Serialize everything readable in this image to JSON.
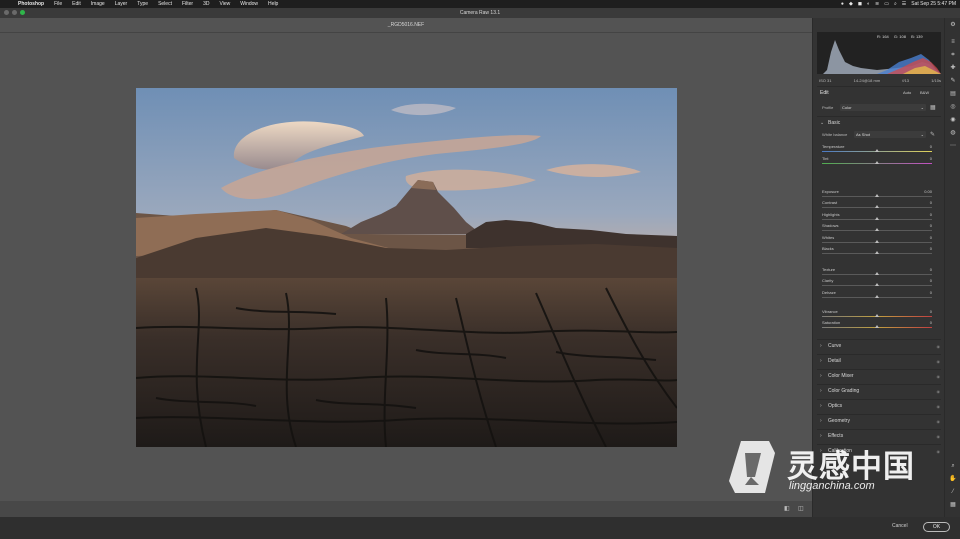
{
  "menubar": {
    "apple": "",
    "items": [
      "Photoshop",
      "File",
      "Edit",
      "Image",
      "Layer",
      "Type",
      "Select",
      "Filter",
      "3D",
      "View",
      "Window",
      "Help"
    ],
    "clock": "Sat Sep 25  5:47 PM"
  },
  "window": {
    "title": "Camera Raw 13.1"
  },
  "file": {
    "name": "_RGD5016.NEF"
  },
  "histogram": {
    "r": "R: 164",
    "g": "G: 108",
    "b": "B: 139"
  },
  "exif": {
    "iso": "ISO 31",
    "lens": "14-24@18 mm",
    "aperture": "f/13",
    "shutter": "1/10s"
  },
  "edit": {
    "title": "Edit",
    "auto": "Auto",
    "bw": "B&W"
  },
  "profile": {
    "label": "Profile",
    "value": "Color"
  },
  "basic": {
    "title": "Basic",
    "white_balance_label": "White balance",
    "white_balance_value": "As Shot",
    "sliders": [
      {
        "label": "Temperature",
        "value": "0",
        "level": 0.5
      },
      {
        "label": "Tint",
        "value": "0",
        "level": 0.5
      },
      {
        "label": "Exposure",
        "value": "0.00",
        "level": 0.5
      },
      {
        "label": "Contrast",
        "value": "0",
        "level": 0.5
      },
      {
        "label": "Highlights",
        "value": "0",
        "level": 0.5
      },
      {
        "label": "Shadows",
        "value": "0",
        "level": 0.5
      },
      {
        "label": "Whites",
        "value": "0",
        "level": 0.5
      },
      {
        "label": "Blacks",
        "value": "0",
        "level": 0.5
      },
      {
        "label": "Texture",
        "value": "0",
        "level": 0.5
      },
      {
        "label": "Clarity",
        "value": "0",
        "level": 0.5
      },
      {
        "label": "Dehaze",
        "value": "0",
        "level": 0.5
      },
      {
        "label": "Vibrance",
        "value": "0",
        "level": 0.5
      },
      {
        "label": "Saturation",
        "value": "0",
        "level": 0.5
      }
    ]
  },
  "sections": [
    "Curve",
    "Detail",
    "Color Mixer",
    "Color Grading",
    "Optics",
    "Geometry",
    "Effects",
    "Calibration"
  ],
  "footer": {
    "cancel": "Cancel",
    "ok": "OK"
  },
  "watermark": {
    "cn": "灵感中国",
    "en": "lingganchina.com"
  },
  "colors": {
    "accent_green": "#2fb54a",
    "panel_bg": "#333333",
    "canvas_bg": "#535353"
  }
}
